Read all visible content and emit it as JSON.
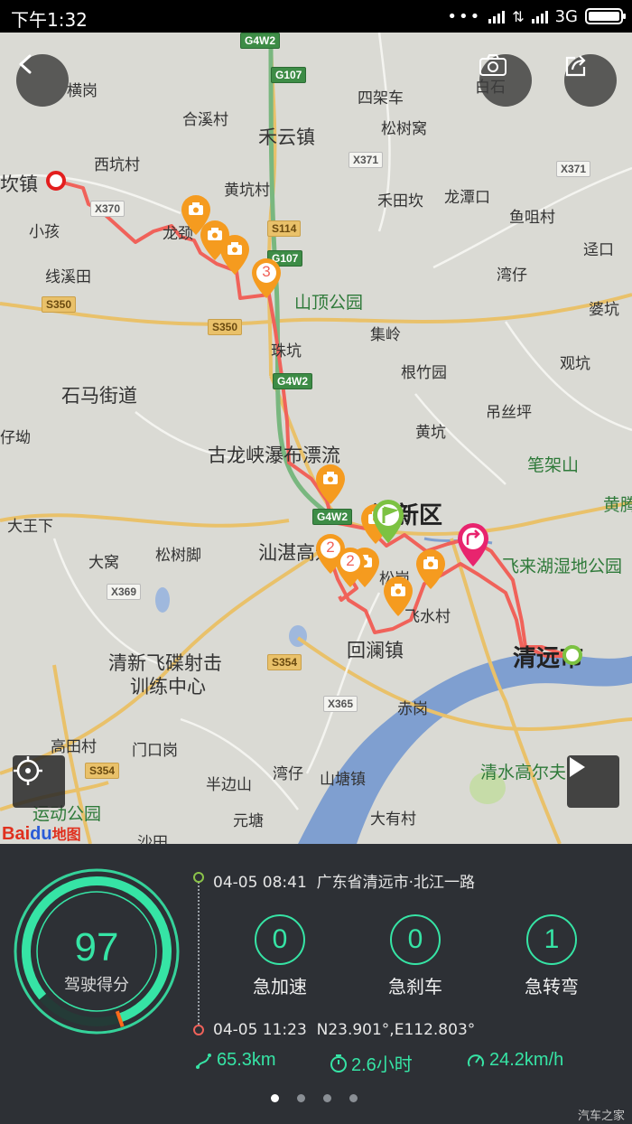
{
  "status_bar": {
    "time": "下午1:32",
    "network": "3G"
  },
  "map": {
    "places": [
      {
        "text": "横岗",
        "cls": "place"
      },
      {
        "text": "合溪村",
        "cls": "place"
      },
      {
        "text": "西坑村",
        "cls": "place"
      },
      {
        "text": "坎镇",
        "cls": "place mid"
      },
      {
        "text": "小孩",
        "cls": "place"
      },
      {
        "text": "线溪田",
        "cls": "place"
      },
      {
        "text": "龙颈",
        "cls": "place"
      },
      {
        "text": "黄坑村",
        "cls": "place"
      },
      {
        "text": "禾云镇",
        "cls": "place mid"
      },
      {
        "text": "四架车",
        "cls": "place"
      },
      {
        "text": "松树窝",
        "cls": "place"
      },
      {
        "text": "禾田坎",
        "cls": "place"
      },
      {
        "text": "龙潭口",
        "cls": "place"
      },
      {
        "text": "鱼咀村",
        "cls": "place"
      },
      {
        "text": "迳口",
        "cls": "place"
      },
      {
        "text": "湾仔",
        "cls": "place"
      },
      {
        "text": "婆坑",
        "cls": "place"
      },
      {
        "text": "观坑",
        "cls": "place"
      },
      {
        "text": "山顶公园",
        "cls": "place green"
      },
      {
        "text": "集岭",
        "cls": "place"
      },
      {
        "text": "珠坑",
        "cls": "place"
      },
      {
        "text": "根竹园",
        "cls": "place"
      },
      {
        "text": "石马街道",
        "cls": "place mid"
      },
      {
        "text": "仔坳",
        "cls": "place"
      },
      {
        "text": "吊丝坪",
        "cls": "place"
      },
      {
        "text": "黄坑",
        "cls": "place"
      },
      {
        "text": "古龙峡瀑布漂流",
        "cls": "place mid"
      },
      {
        "text": "笔架山",
        "cls": "place green"
      },
      {
        "text": "大王下",
        "cls": "place"
      },
      {
        "text": "清新区",
        "cls": "place big"
      },
      {
        "text": "黄腾",
        "cls": "place green"
      },
      {
        "text": "大窝",
        "cls": "place"
      },
      {
        "text": "松树脚",
        "cls": "place"
      },
      {
        "text": "汕湛高速",
        "cls": "place mid"
      },
      {
        "text": "松岗",
        "cls": "place"
      },
      {
        "text": "飞来湖湿地公园",
        "cls": "place green"
      },
      {
        "text": "飞水村",
        "cls": "place"
      },
      {
        "text": "清新飞碟射击",
        "cls": "place mid"
      },
      {
        "text": "训练中心",
        "cls": "place mid"
      },
      {
        "text": "回澜镇",
        "cls": "place mid"
      },
      {
        "text": "清远市",
        "cls": "place big"
      },
      {
        "text": "赤岗",
        "cls": "place"
      },
      {
        "text": "高田村",
        "cls": "place"
      },
      {
        "text": "门口岗",
        "cls": "place"
      },
      {
        "text": "湾仔",
        "cls": "place"
      },
      {
        "text": "山塘镇",
        "cls": "place"
      },
      {
        "text": "清水高尔夫",
        "cls": "place green"
      },
      {
        "text": "半边山",
        "cls": "place"
      },
      {
        "text": "元塘",
        "cls": "place"
      },
      {
        "text": "运动公园",
        "cls": "place green"
      },
      {
        "text": "大有村",
        "cls": "place"
      },
      {
        "text": "沙田",
        "cls": "place"
      },
      {
        "text": "白石",
        "cls": "place"
      }
    ],
    "shields": [
      {
        "text": "G4W2",
        "cls": "shield g"
      },
      {
        "text": "G107",
        "cls": "shield g"
      },
      {
        "text": "S114",
        "cls": "shield s"
      },
      {
        "text": "G107",
        "cls": "shield g"
      },
      {
        "text": "X371",
        "cls": "shield x"
      },
      {
        "text": "X371",
        "cls": "shield x"
      },
      {
        "text": "X370",
        "cls": "shield x"
      },
      {
        "text": "S350",
        "cls": "shield s"
      },
      {
        "text": "S350",
        "cls": "shield s"
      },
      {
        "text": "G4W2",
        "cls": "shield g"
      },
      {
        "text": "G4W2",
        "cls": "shield g"
      },
      {
        "text": "X369",
        "cls": "shield x"
      },
      {
        "text": "S354",
        "cls": "shield s"
      },
      {
        "text": "X365",
        "cls": "shield x"
      },
      {
        "text": "S354",
        "cls": "shield s"
      }
    ],
    "markers": {
      "marker3": "3",
      "marker2a": "2",
      "marker2b": "2"
    },
    "logo": {
      "bai": "Bai",
      "du": "du",
      "text": "地图"
    },
    "colors": {
      "route": "#f0625a",
      "marker": "#f59b1f",
      "start_flag": "#7cc242",
      "end": "#e8246e"
    }
  },
  "trip": {
    "start_time": "04-05 08:41",
    "start_place": "广东省清远市·北江一路",
    "end_time": "04-05 11:23",
    "end_place": "N23.901°,E112.803°",
    "score": "97",
    "score_label": "驾驶得分",
    "score_fraction": 0.97,
    "stats": [
      {
        "value": "0",
        "label": "急加速"
      },
      {
        "value": "0",
        "label": "急刹车"
      },
      {
        "value": "1",
        "label": "急转弯"
      }
    ],
    "distance": "65.3km",
    "duration": "2.6小时",
    "avg_speed": "24.2km/h"
  },
  "pager": {
    "count": 4,
    "active": 0
  },
  "watermark": "汽车之家",
  "colors": {
    "accent": "#36e4a5",
    "panel": "#2d3035",
    "score_marker": "#ff6a1a"
  }
}
